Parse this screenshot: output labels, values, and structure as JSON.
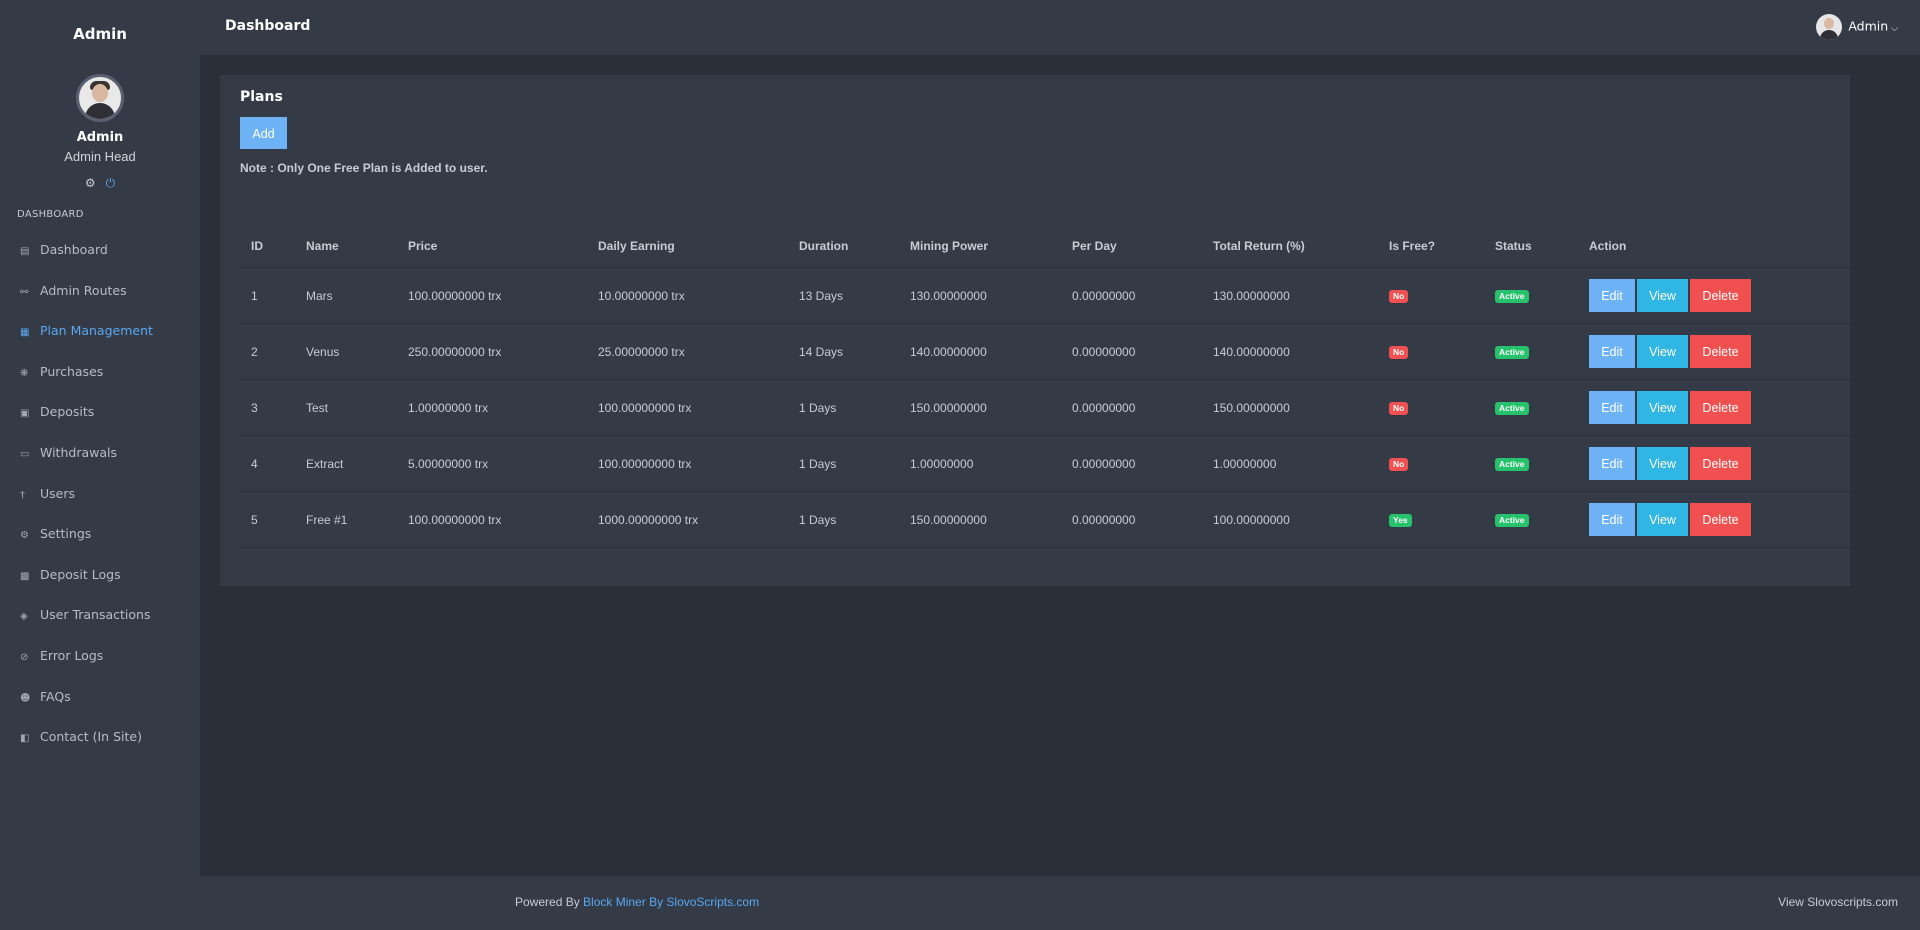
{
  "sidebar": {
    "brand": "Admin",
    "user_name": "Admin",
    "user_role": "Admin Head",
    "heading": "DASHBOARD",
    "items": [
      {
        "label": "Dashboard",
        "icon": "dashboard-icon"
      },
      {
        "label": "Admin Routes",
        "icon": "link-icon"
      },
      {
        "label": "Plan Management",
        "icon": "calendar-icon",
        "active": true
      },
      {
        "label": "Purchases",
        "icon": "fan-icon"
      },
      {
        "label": "Deposits",
        "icon": "wallet-icon"
      },
      {
        "label": "Withdrawals",
        "icon": "credit-card-icon"
      },
      {
        "label": "Users",
        "icon": "user-icon"
      },
      {
        "label": "Settings",
        "icon": "gear-icon"
      },
      {
        "label": "Deposit Logs",
        "icon": "file-icon"
      },
      {
        "label": "User Transactions",
        "icon": "layers-icon"
      },
      {
        "label": "Error Logs",
        "icon": "block-icon"
      },
      {
        "label": "FAQs",
        "icon": "user-question-icon"
      },
      {
        "label": "Contact (In Site)",
        "icon": "contact-icon"
      }
    ]
  },
  "header": {
    "title": "Dashboard",
    "user": "Admin"
  },
  "plans": {
    "title": "Plans",
    "add_label": "Add",
    "note": "Note : Only One Free Plan is Added to user.",
    "columns": [
      "ID",
      "Name",
      "Price",
      "Daily Earning",
      "Duration",
      "Mining Power",
      "Per Day",
      "Total Return (%)",
      "Is Free?",
      "Status",
      "Action"
    ],
    "rows": [
      {
        "id": "1",
        "name": "Mars",
        "price": "100.00000000 trx",
        "daily": "10.00000000 trx",
        "duration": "13 Days",
        "power": "130.00000000",
        "per_day": "0.00000000",
        "total": "130.00000000",
        "free": "No",
        "status": "Active"
      },
      {
        "id": "2",
        "name": "Venus",
        "price": "250.00000000 trx",
        "daily": "25.00000000 trx",
        "duration": "14 Days",
        "power": "140.00000000",
        "per_day": "0.00000000",
        "total": "140.00000000",
        "free": "No",
        "status": "Active"
      },
      {
        "id": "3",
        "name": "Test",
        "price": "1.00000000 trx",
        "daily": "100.00000000 trx",
        "duration": "1 Days",
        "power": "150.00000000",
        "per_day": "0.00000000",
        "total": "150.00000000",
        "free": "No",
        "status": "Active"
      },
      {
        "id": "4",
        "name": "Extract",
        "price": "5.00000000 trx",
        "daily": "100.00000000 trx",
        "duration": "1 Days",
        "power": "1.00000000",
        "per_day": "0.00000000",
        "total": "1.00000000",
        "free": "No",
        "status": "Active"
      },
      {
        "id": "5",
        "name": "Free #1",
        "price": "100.00000000 trx",
        "daily": "1000.00000000 trx",
        "duration": "1 Days",
        "power": "150.00000000",
        "per_day": "0.00000000",
        "total": "100.00000000",
        "free": "Yes",
        "status": "Active"
      }
    ],
    "actions": {
      "edit": "Edit",
      "view": "View",
      "delete": "Delete"
    }
  },
  "footer": {
    "powered_prefix": "Powered By",
    "powered_link": "Block Miner By SlovoScripts.com",
    "right_link": "View Slovoscripts.com"
  },
  "colors": {
    "background": "#2a2f3a",
    "panel": "#343a46",
    "accent": "#5aa8f0",
    "edit": "#6cb2f5",
    "view": "#30b6e2",
    "delete": "#f05050",
    "success": "#27c26c"
  }
}
